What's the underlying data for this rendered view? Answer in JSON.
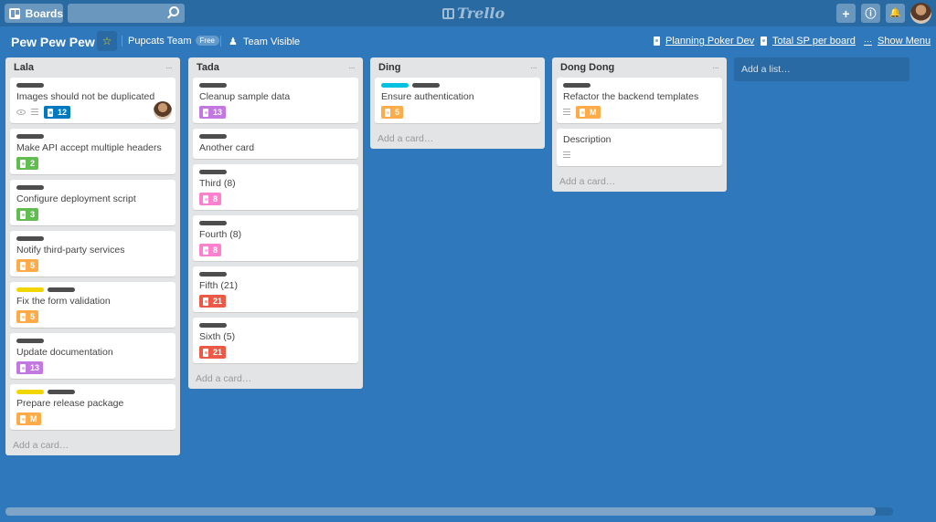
{
  "topbar": {
    "boards_label": "Boards",
    "search_placeholder": "",
    "logo_text": "Trello",
    "add_icon": "+",
    "info_icon": "ⓘ",
    "bell_icon": "🔔"
  },
  "header": {
    "board_title": "Pew Pew Pew",
    "star_icon": "☆",
    "team_name": "Pupcats Team",
    "team_badge": "Free",
    "visibility": "Team Visible",
    "links": [
      {
        "label": "Planning Poker Dev"
      },
      {
        "label": "Total SP per board"
      }
    ],
    "show_menu": "Show Menu",
    "menu_dots": "···"
  },
  "colors": {
    "blue": "#2f78bb",
    "green": "#61bd4f",
    "orange": "#ffab4a",
    "purple": "#c377e0",
    "pink": "#ff80ce",
    "red": "#eb5a46",
    "sp_blue": "#0079bf",
    "label_dark": "#4d4d4d",
    "label_yellow": "#f2d600",
    "label_sky": "#00c2e0"
  },
  "lists": [
    {
      "title": "Lala",
      "add_card": "Add a card…",
      "cards": [
        {
          "title": "Images should not be duplicated",
          "labels": [
            "label_dark"
          ],
          "watch": true,
          "desc": true,
          "sp": "12",
          "sp_color": "sp_blue",
          "avatar": true
        },
        {
          "title": "Make API accept multiple headers",
          "labels": [
            "label_dark"
          ],
          "sp": "2",
          "sp_color": "green"
        },
        {
          "title": "Configure deployment script",
          "labels": [
            "label_dark"
          ],
          "sp": "3",
          "sp_color": "green"
        },
        {
          "title": "Notify third-party services",
          "labels": [
            "label_dark"
          ],
          "sp": "5",
          "sp_color": "orange"
        },
        {
          "title": "Fix the form validation",
          "labels": [
            "label_yellow",
            "label_dark"
          ],
          "sp": "5",
          "sp_color": "orange"
        },
        {
          "title": "Update documentation",
          "labels": [
            "label_dark"
          ],
          "sp": "13",
          "sp_color": "purple"
        },
        {
          "title": "Prepare release package",
          "labels": [
            "label_yellow",
            "label_dark"
          ],
          "sp": "M",
          "sp_color": "orange"
        }
      ]
    },
    {
      "title": "Tada",
      "add_card": "Add a card…",
      "cards": [
        {
          "title": "Cleanup sample data",
          "labels": [
            "label_dark"
          ],
          "sp": "13",
          "sp_color": "purple"
        },
        {
          "title": "Another card",
          "labels": [
            "label_dark"
          ]
        },
        {
          "title": "Third (8)",
          "labels": [
            "label_dark"
          ],
          "sp": "8",
          "sp_color": "pink"
        },
        {
          "title": "Fourth (8)",
          "labels": [
            "label_dark"
          ],
          "sp": "8",
          "sp_color": "pink"
        },
        {
          "title": "Fifth (21)",
          "labels": [
            "label_dark"
          ],
          "sp": "21",
          "sp_color": "red"
        },
        {
          "title": "Sixth (5)",
          "labels": [
            "label_dark"
          ],
          "sp": "21",
          "sp_color": "red"
        }
      ]
    },
    {
      "title": "Ding",
      "add_card": "Add a card…",
      "cards": [
        {
          "title": "Ensure authentication",
          "labels": [
            "label_sky",
            "label_dark"
          ],
          "sp": "5",
          "sp_color": "orange"
        }
      ]
    },
    {
      "title": "Dong Dong",
      "add_card": "Add a card…",
      "cards": [
        {
          "title": "Refactor the backend templates",
          "labels": [
            "label_dark"
          ],
          "desc": true,
          "sp": "M",
          "sp_color": "orange"
        },
        {
          "title": "Description",
          "labels": [],
          "desc": true
        }
      ]
    }
  ],
  "add_list": "Add a list…",
  "scrollbar": {
    "thumb_fraction": 0.98
  }
}
